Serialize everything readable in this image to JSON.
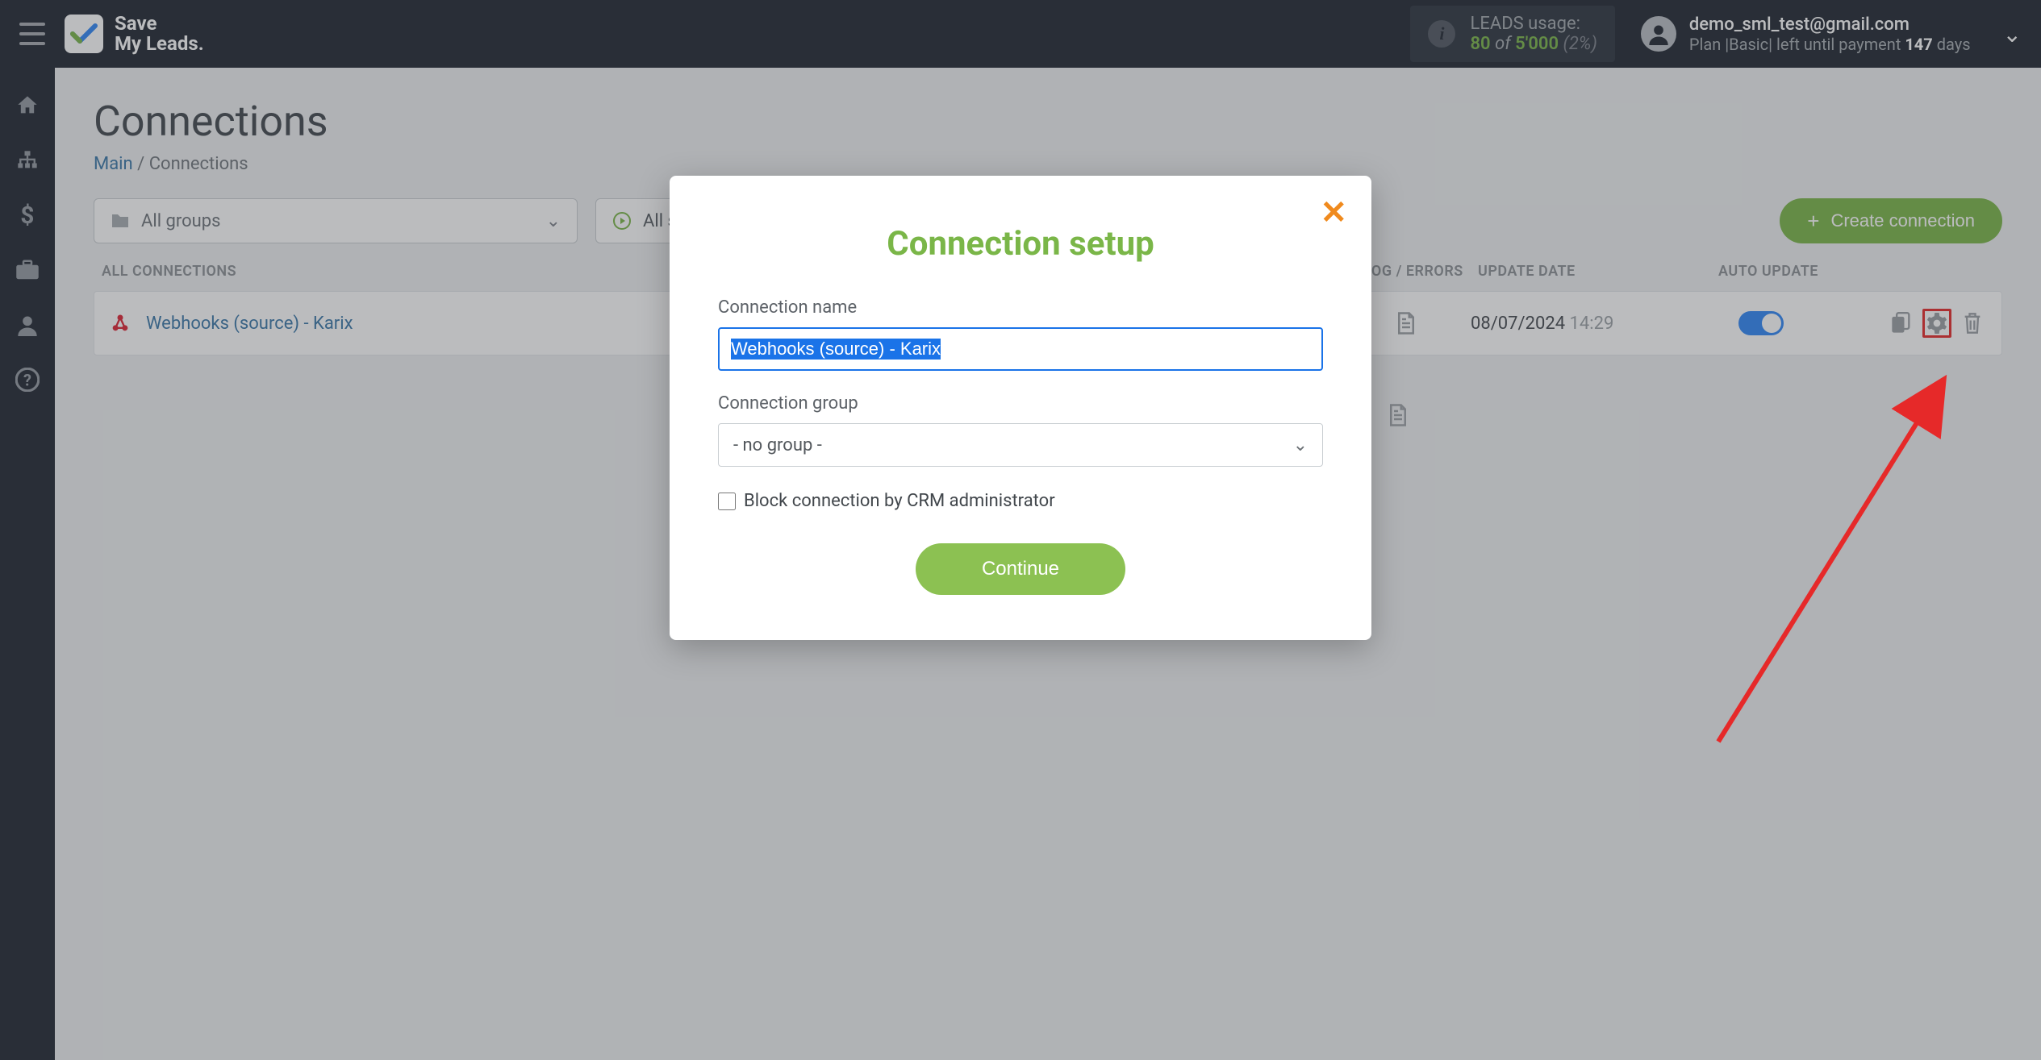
{
  "header": {
    "logo_line1": "Save",
    "logo_line2": "My Leads.",
    "leads_usage_label": "LEADS usage:",
    "leads_used": "80",
    "leads_of": "of",
    "leads_total": "5'000",
    "leads_pct": "(2%)",
    "email": "demo_sml_test@gmail.com",
    "plan_prefix": "Plan ",
    "plan_name": "|Basic|",
    "plan_middle": " left until payment ",
    "plan_days": "147",
    "plan_suffix": " days"
  },
  "sidebar": {
    "items": [
      {
        "name": "home"
      },
      {
        "name": "sitemap"
      },
      {
        "name": "dollar"
      },
      {
        "name": "briefcase"
      },
      {
        "name": "user"
      },
      {
        "name": "help"
      }
    ]
  },
  "page": {
    "title": "Connections",
    "breadcrumb_main": "Main",
    "breadcrumb_sep": " / ",
    "breadcrumb_current": "Connections",
    "group_select": "All groups",
    "status_select": "All statuses",
    "create_button": "Create connection"
  },
  "table": {
    "headers": {
      "all": "ALL CONNECTIONS",
      "log": "LOG / ERRORS",
      "update": "UPDATE DATE",
      "auto": "AUTO UPDATE"
    },
    "rows": [
      {
        "name": "Webhooks (source) - Karix",
        "date": "08/07/2024",
        "time": "14:29",
        "auto": true
      }
    ]
  },
  "modal": {
    "title": "Connection setup",
    "label_name": "Connection name",
    "input_name_value": "Webhooks (source) - Karix",
    "label_group": "Connection group",
    "group_value": "- no group -",
    "checkbox_label": "Block connection by CRM administrator",
    "continue": "Continue"
  }
}
